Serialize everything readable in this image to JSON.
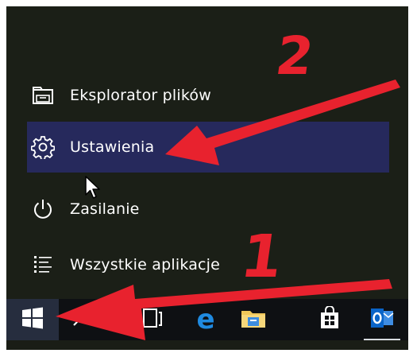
{
  "start_menu": {
    "items": [
      {
        "label": "Eksplorator plików",
        "icon": "file-explorer-icon",
        "highlighted": false
      },
      {
        "label": "Ustawienia",
        "icon": "gear-icon",
        "highlighted": true
      },
      {
        "label": "Zasilanie",
        "icon": "power-icon",
        "highlighted": false
      },
      {
        "label": "Wszystkie aplikacje",
        "icon": "all-apps-list-icon",
        "highlighted": false
      }
    ],
    "highlight_color": "#26295c"
  },
  "taskbar": {
    "buttons": [
      {
        "name": "start-button",
        "icon": "windows-logo-icon",
        "active": true
      },
      {
        "name": "search-button",
        "icon": "search-icon"
      },
      {
        "name": "task-view-button",
        "icon": "task-view-icon"
      },
      {
        "name": "edge-button",
        "icon": "edge-icon"
      },
      {
        "name": "file-explorer-button",
        "icon": "folder-icon"
      },
      {
        "name": "store-button",
        "icon": "store-bag-icon"
      },
      {
        "name": "outlook-button",
        "icon": "outlook-icon",
        "active": true
      }
    ]
  },
  "annotations": {
    "step1": "1",
    "step2": "2",
    "color": "#e8222e"
  }
}
